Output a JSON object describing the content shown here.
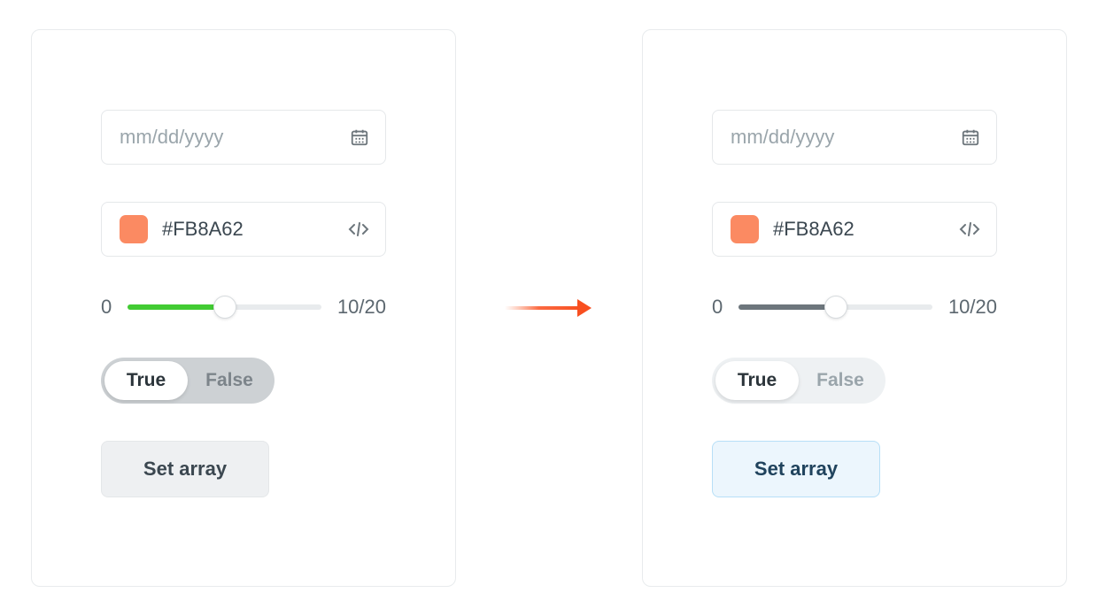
{
  "date": {
    "placeholder": "mm/dd/yyyy"
  },
  "color": {
    "swatch_hex": "#FB8A62",
    "value_label": "#FB8A62"
  },
  "slider": {
    "min_label": "0",
    "value": 10,
    "max": 20,
    "readout": "10/20"
  },
  "toggle": {
    "true_label": "True",
    "false_label": "False",
    "selected": "True"
  },
  "button": {
    "label": "Set array"
  },
  "variants": {
    "left": {
      "slider_color": "green",
      "button_style": "grey",
      "toggle_style": "variant-a"
    },
    "right": {
      "slider_color": "grey",
      "button_style": "blue",
      "toggle_style": "variant-b"
    }
  }
}
